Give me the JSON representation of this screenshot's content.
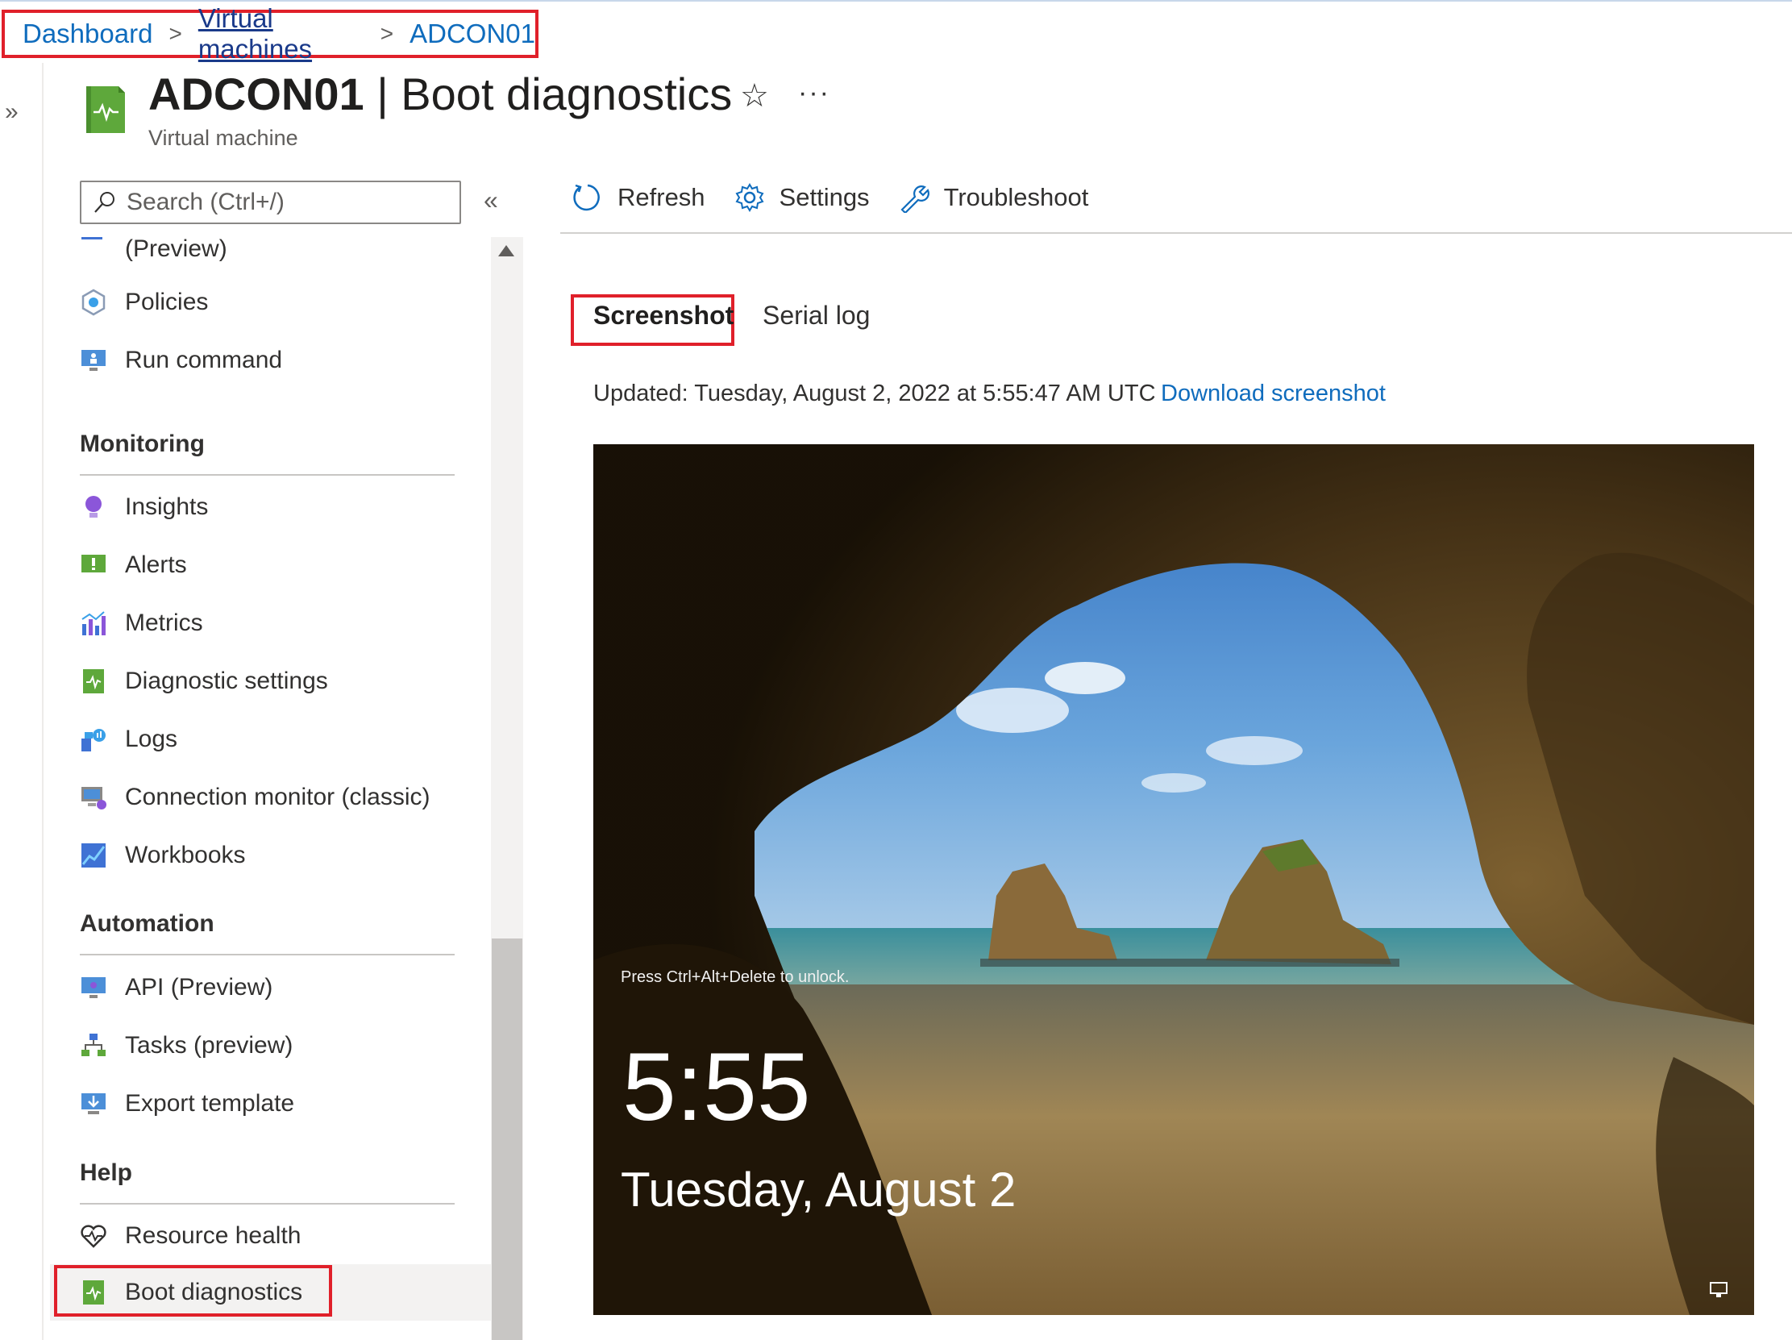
{
  "breadcrumb": {
    "items": [
      "Dashboard",
      "Virtual machines",
      "ADCON01"
    ]
  },
  "header": {
    "resource_name": "ADCON01",
    "separator": "|",
    "page_name": "Boot diagnostics",
    "subtitle": "Virtual machine",
    "favorite_icon": "star-icon",
    "more_label": "···"
  },
  "search": {
    "placeholder": "Search (Ctrl+/)"
  },
  "sidebar": {
    "partial_item": "(Preview)",
    "items_top": [
      "Policies",
      "Run command"
    ],
    "monitoring": {
      "title": "Monitoring",
      "items": [
        "Insights",
        "Alerts",
        "Metrics",
        "Diagnostic settings",
        "Logs",
        "Connection monitor (classic)",
        "Workbooks"
      ]
    },
    "automation": {
      "title": "Automation",
      "items": [
        "API (Preview)",
        "Tasks (preview)",
        "Export template"
      ]
    },
    "help": {
      "title": "Help",
      "items": [
        "Resource health",
        "Boot diagnostics"
      ]
    },
    "selected": "Boot diagnostics"
  },
  "toolbar": {
    "refresh": "Refresh",
    "settings": "Settings",
    "troubleshoot": "Troubleshoot"
  },
  "tabs": {
    "active": "Screenshot",
    "other": "Serial log"
  },
  "status": {
    "updated": "Updated: Tuesday, August 2, 2022 at 5:55:47 AM UTC",
    "download": "Download screenshot"
  },
  "lock_screen": {
    "hint": "Press Ctrl+Alt+Delete to unlock.",
    "time": "5:55",
    "date": "Tuesday, August 2"
  },
  "colors": {
    "accent": "#0f6cbd",
    "highlight": "#e0202a",
    "vm_icon": "#5ea83b"
  }
}
